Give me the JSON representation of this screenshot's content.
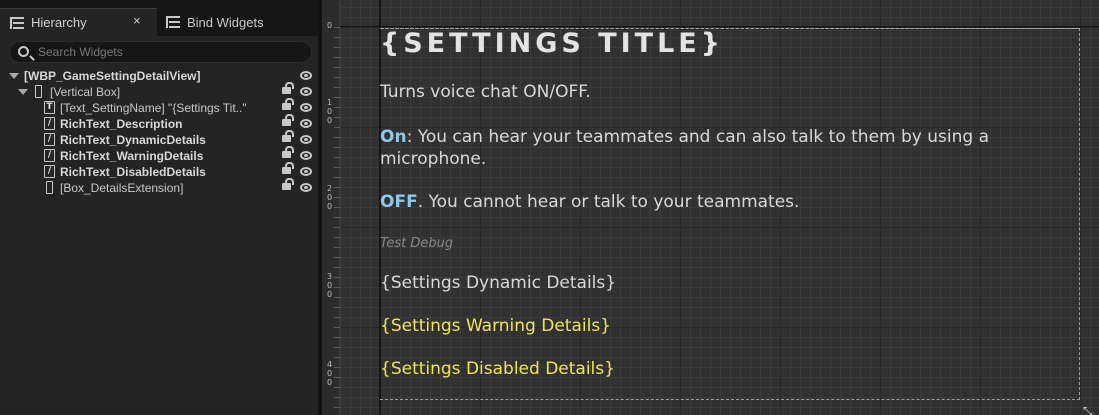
{
  "tabs": {
    "hierarchy": "Hierarchy",
    "bind_widgets": "Bind Widgets",
    "close_glyph": "×"
  },
  "search": {
    "placeholder": "Search Widgets"
  },
  "tree": [
    {
      "label": "[WBP_GameSettingDetailView]",
      "icon": "none",
      "bold": true
    },
    {
      "label": "[Vertical Box]",
      "icon": "vertical-box-icon",
      "bold": false
    },
    {
      "label": "[Text_SettingName] \"{Settings Tit..\"",
      "icon": "text-icon",
      "icon_glyph": "T",
      "bold": false
    },
    {
      "label": "RichText_Description",
      "icon": "rich-text-icon",
      "icon_glyph": "/",
      "bold": true
    },
    {
      "label": "RichText_DynamicDetails",
      "icon": "rich-text-icon",
      "icon_glyph": "/",
      "bold": true
    },
    {
      "label": "RichText_WarningDetails",
      "icon": "rich-text-icon",
      "icon_glyph": "/",
      "bold": true
    },
    {
      "label": "RichText_DisabledDetails",
      "icon": "rich-text-icon",
      "icon_glyph": "/",
      "bold": true
    },
    {
      "label": "[Box_DetailsExtension]",
      "icon": "vertical-box-icon",
      "bold": false
    }
  ],
  "ruler": {
    "labels": [
      {
        "text": "0"
      },
      {
        "text": "1\n0\n0"
      },
      {
        "text": "2\n0\n0"
      },
      {
        "text": "3\n0\n0"
      },
      {
        "text": "4\n0\n0"
      }
    ]
  },
  "preview": {
    "title": "{SETTINGS TITLE}",
    "description": "Turns voice chat ON/OFF.",
    "on_keyword": "On",
    "on_text": ": You can hear your teammates and can also talk to them by using a microphone.",
    "off_keyword": "OFF",
    "off_text": ". You cannot hear or talk to your teammates.",
    "debug": "Test Debug",
    "dynamic": "{Settings Dynamic Details}",
    "warning": "{Settings Warning Details}",
    "disabled": "{Settings Disabled Details}"
  },
  "colors": {
    "keyword": "#8fc8e8",
    "warning": "#f0e650",
    "disabled": "#f0e650"
  }
}
